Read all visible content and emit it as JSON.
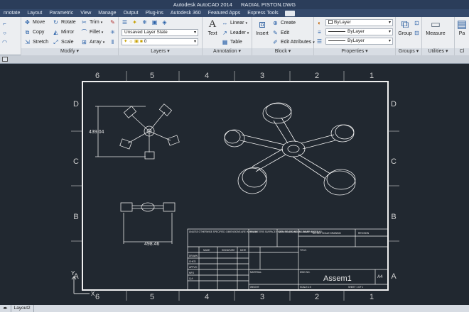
{
  "window": {
    "app_title": "Autodesk AutoCAD 2014",
    "file_title": "RADIAL PISTON.DWG"
  },
  "ribbon_tabs": [
    "nnotate",
    "Layout",
    "Parametric",
    "View",
    "Manage",
    "Output",
    "Plug-ins",
    "Autodesk 360",
    "Featured Apps",
    "Express Tools"
  ],
  "modify": {
    "title": "Modify",
    "move": "Move",
    "rotate": "Rotate",
    "trim": "Trim",
    "copy": "Copy",
    "mirror": "Mirror",
    "fillet": "Fillet",
    "stretch": "Stretch",
    "scale": "Scale",
    "array": "Array"
  },
  "layers": {
    "title": "Layers",
    "state_value": "Unsaved Layer State",
    "current_layer": "0"
  },
  "annotation": {
    "title": "Annotation",
    "text": "Text",
    "linear": "Linear",
    "leader": "Leader",
    "table": "Table"
  },
  "block": {
    "title": "Block",
    "insert": "Insert",
    "create": "Create",
    "edit": "Edit",
    "edit_attributes": "Edit Attributes"
  },
  "properties": {
    "title": "Properties",
    "color": "ByLayer",
    "linetype": "ByLayer",
    "lineweight": "ByLayer"
  },
  "groups": {
    "title": "Groups",
    "group": "Group"
  },
  "utilities": {
    "title": "Utilities",
    "measure": "Measure"
  },
  "clipboard": {
    "paste": "Pa",
    "title": "Cl"
  },
  "drawing": {
    "col_labels": [
      "6",
      "5",
      "4",
      "3",
      "2",
      "1"
    ],
    "row_labels": [
      "D",
      "C",
      "B",
      "A"
    ],
    "dim_vertical": "439.04",
    "dim_horizontal": "498.46",
    "title_name": "Assem1",
    "sheet_size": "A4",
    "titleblock_notes": "UNLESS OTHERWISE SPECIFIED: DIMENSIONS ARE IN MILLIMETERS SURFACE FINISH: TOLERANCES: LINEAR: ANGULAR:",
    "tb_finish": "FINISH",
    "tb_deburr": "DEBURR AND BREAK SHARP EDGES",
    "tb_noscale": "DO NOT SCALE DRAWING",
    "tb_revision": "REVISION",
    "tb_name": "NAME",
    "tb_signature": "SIGNATURE",
    "tb_date": "DATE",
    "tb_title": "TITLE:",
    "tb_rows": [
      "DRAWN",
      "CHK'D",
      "APPV'D",
      "MFG",
      "Q.A"
    ],
    "tb_material": "MATERIAL:",
    "tb_weight": "WEIGHT:",
    "tb_dwgno": "DWG NO.",
    "tb_scale": "SCALE:1:5",
    "tb_sheet": "SHEET 1 OF 1",
    "ucs_x": "X",
    "ucs_y": "Y"
  },
  "layout_tabs": [
    "Layout2"
  ],
  "colors": {
    "frame": "#f2f2f2",
    "canvas": "#212830",
    "ribbon": "#eceef1"
  }
}
